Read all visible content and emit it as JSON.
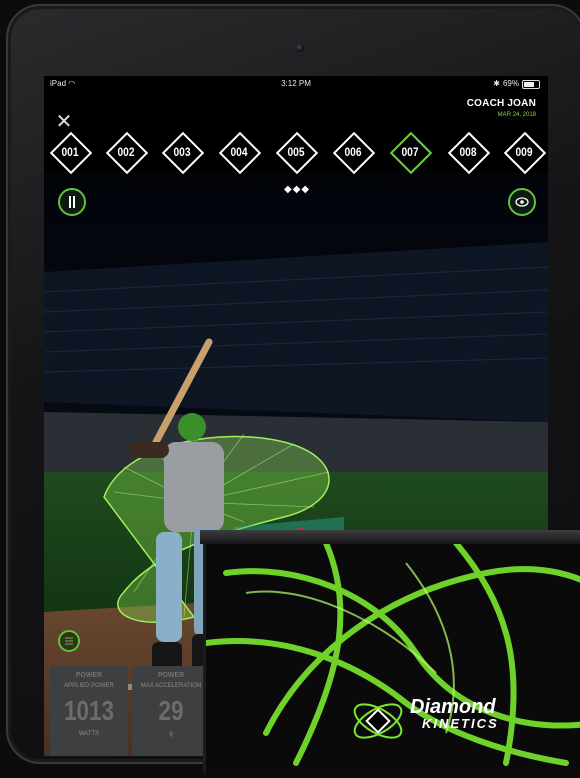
{
  "status_bar": {
    "device": "iPad",
    "time": "3:12 PM",
    "battery": "69%"
  },
  "header": {
    "coach_name": "COACH JOAN",
    "date": "MAR 24, 2018"
  },
  "swings": [
    {
      "label": "001",
      "active": false
    },
    {
      "label": "002",
      "active": false
    },
    {
      "label": "003",
      "active": false
    },
    {
      "label": "004",
      "active": false
    },
    {
      "label": "005",
      "active": false
    },
    {
      "label": "006",
      "active": false
    },
    {
      "label": "007",
      "active": true
    },
    {
      "label": "008",
      "active": false
    },
    {
      "label": "009",
      "active": false
    }
  ],
  "metrics": [
    {
      "title": "POWER",
      "subtitle": "APPLIED POWER",
      "value": "1013",
      "unit": "WATTS"
    },
    {
      "title": "POWER",
      "subtitle": "MAX ACCELERATION",
      "value": "29",
      "unit": "g"
    }
  ],
  "brand": {
    "name": "Diamond",
    "sub": "KINETICS"
  },
  "icons": {
    "close": "close-icon",
    "bats": "bat-toggle-icon",
    "eye": "eye-icon",
    "menu": "menu-icon",
    "more": "more-dots-icon"
  },
  "colors": {
    "accent": "#6fd23a",
    "background": "#000000"
  }
}
